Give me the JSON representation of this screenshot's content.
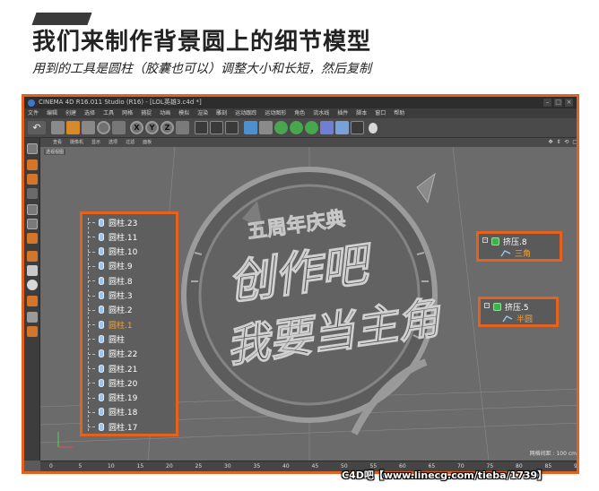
{
  "header": {
    "title": "我们来制作背景圆上的细节模型",
    "subtitle": "用到的工具是圆柱（胶囊也可以）调整大小和长短，然后复制"
  },
  "window": {
    "title": "CINEMA 4D R16.011 Studio (R16) - [LOL英雄3.c4d *]"
  },
  "menu": [
    "文件",
    "编辑",
    "创建",
    "选择",
    "工具",
    "网格",
    "捕捉",
    "动画",
    "模拟",
    "渲染",
    "雕刻",
    "运动跟踪",
    "运动图形",
    "角色",
    "流水线",
    "插件",
    "脚本",
    "窗口",
    "帮助"
  ],
  "toolbar": {
    "axis_buttons": [
      "X",
      "Y",
      "Z"
    ]
  },
  "viewport": {
    "menu": [
      "查看",
      "摄像机",
      "显示",
      "选项",
      "过滤",
      "面板"
    ],
    "nav_icons": "✥ ⇕ ⟲ ▢",
    "label": "透视视图",
    "grid_info": "网格间距 : 100 cm"
  },
  "outliner": {
    "items": [
      {
        "label": "圆柱.23",
        "active": false
      },
      {
        "label": "圆柱.11",
        "active": false
      },
      {
        "label": "圆柱.10",
        "active": false
      },
      {
        "label": "圆柱.9",
        "active": false
      },
      {
        "label": "圆柱.8",
        "active": false
      },
      {
        "label": "圆柱.3",
        "active": false
      },
      {
        "label": "圆柱.2",
        "active": false
      },
      {
        "label": "圆柱.1",
        "active": true
      },
      {
        "label": "圆柱",
        "active": false
      },
      {
        "label": "圆柱.22",
        "active": false
      },
      {
        "label": "圆柱.21",
        "active": false
      },
      {
        "label": "圆柱.20",
        "active": false
      },
      {
        "label": "圆柱.19",
        "active": false
      },
      {
        "label": "圆柱.18",
        "active": false
      },
      {
        "label": "圆柱.17",
        "active": false
      }
    ]
  },
  "extrude_panels": [
    {
      "parent": "挤压.8",
      "child": "三角"
    },
    {
      "parent": "挤压.5",
      "child": "半圆"
    }
  ],
  "scene_text": {
    "line1": "五周年庆典",
    "line2": "创作吧",
    "line3": "我要当主角"
  },
  "timeline": {
    "ticks": [
      "0",
      "5",
      "10",
      "15",
      "20",
      "25",
      "30",
      "35",
      "40",
      "45",
      "50",
      "55",
      "60",
      "65",
      "70",
      "75",
      "80",
      "85",
      "90"
    ]
  },
  "watermark": "C4D吧【www.linecg.com/tieba/1739】",
  "colors": {
    "accent": "#e5621e",
    "active_item": "#f0a040"
  }
}
